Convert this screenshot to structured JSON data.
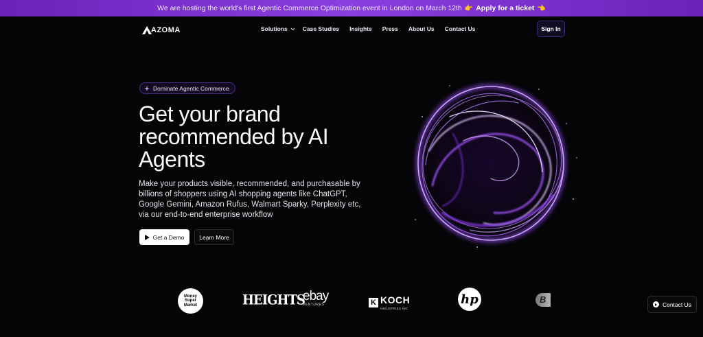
{
  "banner": {
    "text": "We are hosting the world's first Agentic Commerce Optimization event in London on March 12th",
    "emoji_left": "👉",
    "cta": "Apply for a ticket",
    "emoji_right": "👈"
  },
  "nav": {
    "logo": "AZOMA",
    "items": [
      "Solutions",
      "Case Studies",
      "Insights",
      "Press",
      "About Us",
      "Contact Us"
    ],
    "signin": "Sign In"
  },
  "hero": {
    "pill": "Dominate Agentic Commerce",
    "title": "Get your brand recommended by AI Agents",
    "subtitle": "Make your products visible, recommended, and purchasable by billions of shoppers using AI shopping agents like ChatGPT, Google Gemini, Amazon Rufus, Walmart Sparky, Perplexity etc, via our end-to-end enterprise workflow",
    "demo_button": "Get a Demo",
    "learn_button": "Learn More"
  },
  "logos": {
    "money_super_market": "Money Super Market",
    "heights": "HEIGHTS",
    "ebay": "ebay",
    "ebay_sub": "VENTURES",
    "koch": "KOCH",
    "koch_sub": "INDUSTRIES INC",
    "hp": "hp",
    "partial": "B"
  },
  "contact_button": "Contact Us",
  "colors": {
    "banner": "#7b32d0",
    "accent": "#8a3fe0",
    "background": "#050507"
  }
}
